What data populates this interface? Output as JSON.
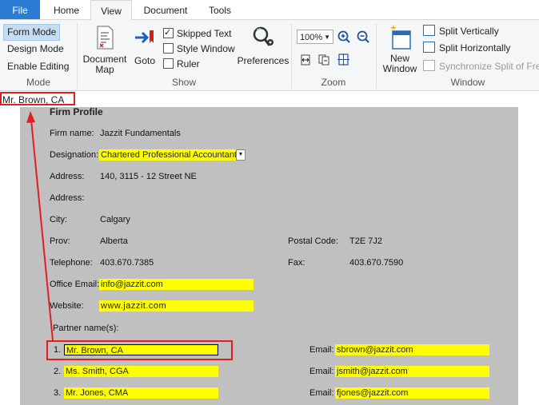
{
  "tabs": [
    {
      "label": "File"
    },
    {
      "label": "Home"
    },
    {
      "label": "View"
    },
    {
      "label": "Document"
    },
    {
      "label": "Tools"
    }
  ],
  "ribbon": {
    "mode": {
      "form_mode": "Form Mode",
      "design_mode": "Design Mode",
      "enable_editing": "Enable Editing",
      "label": "Mode"
    },
    "show": {
      "document_map": "Document Map",
      "goto": "Goto",
      "skipped_text": "Skipped Text",
      "style_window": "Style Window",
      "ruler": "Ruler",
      "label": "Show"
    },
    "preferences": "Preferences",
    "zoom": {
      "value": "100%",
      "label": "Zoom"
    },
    "window": {
      "new_window": "New Window",
      "split_vertically": "Split Vertically",
      "split_horizontally": "Split Horizontally",
      "sync_split": "Synchronize Split of Free",
      "label": "Window"
    }
  },
  "field_bar": {
    "value": "Mr. Brown, CA"
  },
  "form": {
    "title": "Firm Profile",
    "firm_name_label": "Firm name:",
    "firm_name": "Jazzit Fundamentals",
    "designation_label": "Designation:",
    "designation": "Chartered Professional Accountant",
    "address_label": "Address:",
    "address1": "140, 3115 - 12 Street NE",
    "address2_label": "Address:",
    "city_label": "City:",
    "city": "Calgary",
    "prov_label": "Prov:",
    "prov": "Alberta",
    "postal_label": "Postal Code:",
    "postal": "T2E 7J2",
    "telephone_label": "Telephone:",
    "telephone": "403.670.7385",
    "fax_label": "Fax:",
    "fax": "403.670.7590",
    "office_email_label": "Office Email:",
    "office_email": "info@jazzit.com",
    "website_label": "Website:",
    "website": "www.jazzit.com",
    "partners_label": "Partner name(s):",
    "email_label": "Email:",
    "partners": [
      {
        "num": "1.",
        "name": "Mr. Brown, CA",
        "email": "sbrown@jazzit.com"
      },
      {
        "num": "2.",
        "name": "Ms. Smith, CGA",
        "email": "jsmith@jazzit.com"
      },
      {
        "num": "3.",
        "name": "Mr. Jones, CMA",
        "email": "fjones@jazzit.com"
      }
    ]
  }
}
